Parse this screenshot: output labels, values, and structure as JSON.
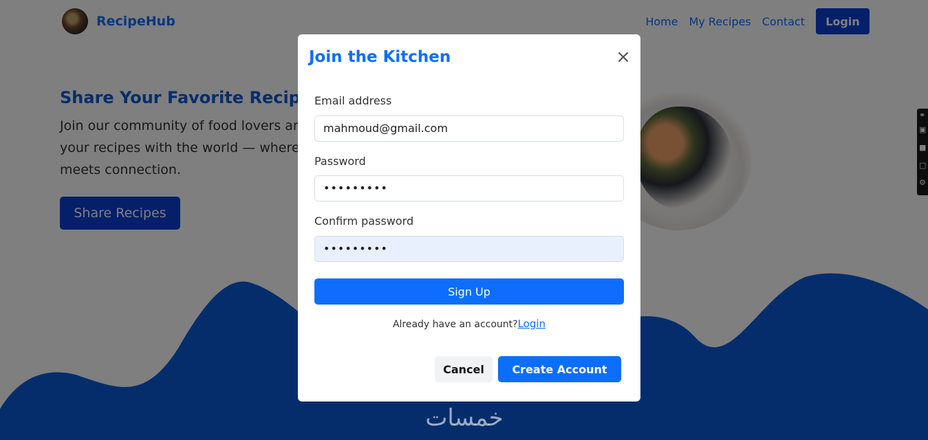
{
  "navbar": {
    "brand": "RecipeHub",
    "links": [
      "Home",
      "My Recipes",
      "Contact"
    ],
    "login_label": "Login"
  },
  "hero": {
    "title": "Share Your Favorite Recipes",
    "text": "Join our community of food lovers and share your recipes with the world — where culinary meets connection.",
    "button_label": "Share Recipes"
  },
  "modal": {
    "title": "Join the Kitchen",
    "close_glyph": "×",
    "email_label": "Email address",
    "email_value": "mahmoud@gmail.com",
    "password_label": "Password",
    "password_value": "•••••••••",
    "confirm_label": "Confirm password",
    "confirm_value": "•••••••••",
    "signup_label": "Sign Up",
    "account_prompt": "Already have an account?",
    "account_link": "Login",
    "cancel_label": "Cancel",
    "create_label": "Create Account"
  },
  "watermark": "خمسات",
  "colors": {
    "primary": "#0d6efd",
    "dark_primary": "#0d3fd6",
    "wave": "#0d5bd7",
    "overlay": "rgba(0,0,0,0.5)"
  },
  "icons": [
    "close-icon",
    "gear-icon",
    "camera-icon",
    "window-icon",
    "link-icon"
  ]
}
